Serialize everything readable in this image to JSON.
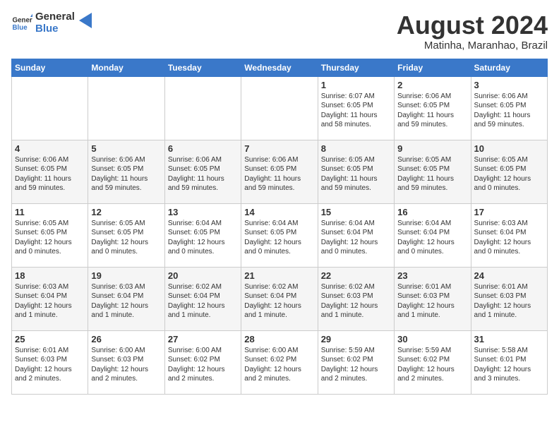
{
  "header": {
    "logo_general": "General",
    "logo_blue": "Blue",
    "month_year": "August 2024",
    "location": "Matinha, Maranhao, Brazil"
  },
  "days_of_week": [
    "Sunday",
    "Monday",
    "Tuesday",
    "Wednesday",
    "Thursday",
    "Friday",
    "Saturday"
  ],
  "weeks": [
    [
      {
        "day": "",
        "info": ""
      },
      {
        "day": "",
        "info": ""
      },
      {
        "day": "",
        "info": ""
      },
      {
        "day": "",
        "info": ""
      },
      {
        "day": "1",
        "info": "Sunrise: 6:07 AM\nSunset: 6:05 PM\nDaylight: 11 hours\nand 58 minutes."
      },
      {
        "day": "2",
        "info": "Sunrise: 6:06 AM\nSunset: 6:05 PM\nDaylight: 11 hours\nand 59 minutes."
      },
      {
        "day": "3",
        "info": "Sunrise: 6:06 AM\nSunset: 6:05 PM\nDaylight: 11 hours\nand 59 minutes."
      }
    ],
    [
      {
        "day": "4",
        "info": "Sunrise: 6:06 AM\nSunset: 6:05 PM\nDaylight: 11 hours\nand 59 minutes."
      },
      {
        "day": "5",
        "info": "Sunrise: 6:06 AM\nSunset: 6:05 PM\nDaylight: 11 hours\nand 59 minutes."
      },
      {
        "day": "6",
        "info": "Sunrise: 6:06 AM\nSunset: 6:05 PM\nDaylight: 11 hours\nand 59 minutes."
      },
      {
        "day": "7",
        "info": "Sunrise: 6:06 AM\nSunset: 6:05 PM\nDaylight: 11 hours\nand 59 minutes."
      },
      {
        "day": "8",
        "info": "Sunrise: 6:05 AM\nSunset: 6:05 PM\nDaylight: 11 hours\nand 59 minutes."
      },
      {
        "day": "9",
        "info": "Sunrise: 6:05 AM\nSunset: 6:05 PM\nDaylight: 11 hours\nand 59 minutes."
      },
      {
        "day": "10",
        "info": "Sunrise: 6:05 AM\nSunset: 6:05 PM\nDaylight: 12 hours\nand 0 minutes."
      }
    ],
    [
      {
        "day": "11",
        "info": "Sunrise: 6:05 AM\nSunset: 6:05 PM\nDaylight: 12 hours\nand 0 minutes."
      },
      {
        "day": "12",
        "info": "Sunrise: 6:05 AM\nSunset: 6:05 PM\nDaylight: 12 hours\nand 0 minutes."
      },
      {
        "day": "13",
        "info": "Sunrise: 6:04 AM\nSunset: 6:05 PM\nDaylight: 12 hours\nand 0 minutes."
      },
      {
        "day": "14",
        "info": "Sunrise: 6:04 AM\nSunset: 6:05 PM\nDaylight: 12 hours\nand 0 minutes."
      },
      {
        "day": "15",
        "info": "Sunrise: 6:04 AM\nSunset: 6:04 PM\nDaylight: 12 hours\nand 0 minutes."
      },
      {
        "day": "16",
        "info": "Sunrise: 6:04 AM\nSunset: 6:04 PM\nDaylight: 12 hours\nand 0 minutes."
      },
      {
        "day": "17",
        "info": "Sunrise: 6:03 AM\nSunset: 6:04 PM\nDaylight: 12 hours\nand 0 minutes."
      }
    ],
    [
      {
        "day": "18",
        "info": "Sunrise: 6:03 AM\nSunset: 6:04 PM\nDaylight: 12 hours\nand 1 minute."
      },
      {
        "day": "19",
        "info": "Sunrise: 6:03 AM\nSunset: 6:04 PM\nDaylight: 12 hours\nand 1 minute."
      },
      {
        "day": "20",
        "info": "Sunrise: 6:02 AM\nSunset: 6:04 PM\nDaylight: 12 hours\nand 1 minute."
      },
      {
        "day": "21",
        "info": "Sunrise: 6:02 AM\nSunset: 6:04 PM\nDaylight: 12 hours\nand 1 minute."
      },
      {
        "day": "22",
        "info": "Sunrise: 6:02 AM\nSunset: 6:03 PM\nDaylight: 12 hours\nand 1 minute."
      },
      {
        "day": "23",
        "info": "Sunrise: 6:01 AM\nSunset: 6:03 PM\nDaylight: 12 hours\nand 1 minute."
      },
      {
        "day": "24",
        "info": "Sunrise: 6:01 AM\nSunset: 6:03 PM\nDaylight: 12 hours\nand 1 minute."
      }
    ],
    [
      {
        "day": "25",
        "info": "Sunrise: 6:01 AM\nSunset: 6:03 PM\nDaylight: 12 hours\nand 2 minutes."
      },
      {
        "day": "26",
        "info": "Sunrise: 6:00 AM\nSunset: 6:03 PM\nDaylight: 12 hours\nand 2 minutes."
      },
      {
        "day": "27",
        "info": "Sunrise: 6:00 AM\nSunset: 6:02 PM\nDaylight: 12 hours\nand 2 minutes."
      },
      {
        "day": "28",
        "info": "Sunrise: 6:00 AM\nSunset: 6:02 PM\nDaylight: 12 hours\nand 2 minutes."
      },
      {
        "day": "29",
        "info": "Sunrise: 5:59 AM\nSunset: 6:02 PM\nDaylight: 12 hours\nand 2 minutes."
      },
      {
        "day": "30",
        "info": "Sunrise: 5:59 AM\nSunset: 6:02 PM\nDaylight: 12 hours\nand 2 minutes."
      },
      {
        "day": "31",
        "info": "Sunrise: 5:58 AM\nSunset: 6:01 PM\nDaylight: 12 hours\nand 3 minutes."
      }
    ]
  ]
}
